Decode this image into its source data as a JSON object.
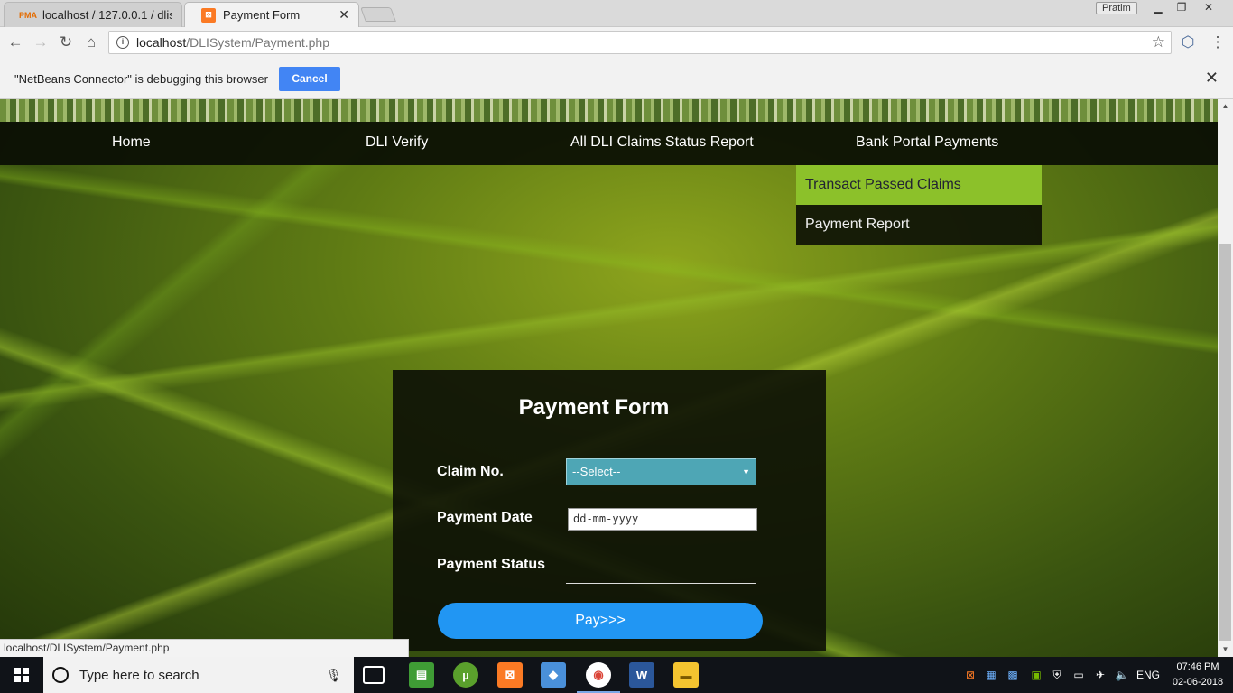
{
  "browser": {
    "tabs": [
      {
        "title": "localhost / 127.0.0.1 / dlis",
        "favicon": "phpmyadmin-icon",
        "active": false
      },
      {
        "title": "Payment Form",
        "favicon": "xampp-icon",
        "active": true
      }
    ],
    "profile_name": "Pratim",
    "url_host": "localhost",
    "url_path": "/DLISystem/Payment.php",
    "infobar_message": "\"NetBeans Connector\" is debugging this browser",
    "infobar_cancel": "Cancel",
    "status_url": "localhost/DLISystem/Payment.php"
  },
  "nav": {
    "items": [
      "Home",
      "DLI Verify",
      "All DLI Claims Status Report",
      "Bank Portal Payments"
    ],
    "dropdown": [
      "Transact Passed Claims",
      "Payment Report"
    ]
  },
  "form": {
    "title": "Payment Form",
    "claim_label": "Claim No.",
    "claim_value": "--Select--",
    "date_label": "Payment Date",
    "date_placeholder": "dd-mm-yyyy",
    "status_label": "Payment Status",
    "status_value": "",
    "pay_button": "Pay>>>"
  },
  "taskbar": {
    "search_placeholder": "Type here to search",
    "language": "ENG",
    "time": "07:46 PM",
    "date": "02-06-2018"
  },
  "colors": {
    "accent": "#4285f4",
    "menu_highlight": "#8cc12a",
    "select_bg": "#4ea6b5",
    "pay_button": "#2196f3"
  }
}
